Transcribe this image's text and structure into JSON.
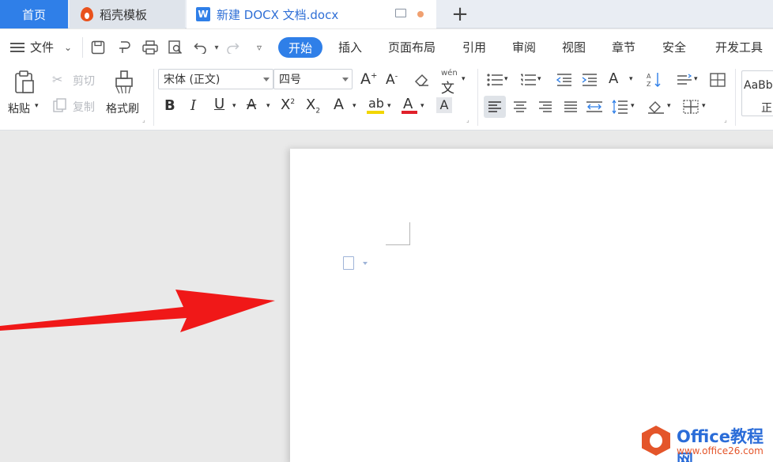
{
  "tabs": {
    "home": "首页",
    "template": "稻壳模板",
    "doc": "新建 DOCX 文档.docx",
    "doc_logo": "W",
    "add": "+"
  },
  "menu": {
    "file": "文件",
    "items": [
      "开始",
      "插入",
      "页面布局",
      "引用",
      "审阅",
      "视图",
      "章节",
      "安全",
      "开发工具"
    ],
    "active_index": 0
  },
  "ribbon": {
    "paste": "粘贴",
    "cut": "剪切",
    "copy": "复制",
    "format_painter": "格式刷",
    "font": "宋体 (正文)",
    "size": "四号",
    "phonetic": "wén",
    "style_sample": "AaBb",
    "style_name": "正"
  },
  "watermark": {
    "title": "Office教程网",
    "url": "www.office26.com"
  },
  "colors": {
    "accent": "#2f7fe8",
    "arrow": "#f01818",
    "font_color_bar": "#e0202a",
    "highlight_bar": "#f2d600"
  }
}
